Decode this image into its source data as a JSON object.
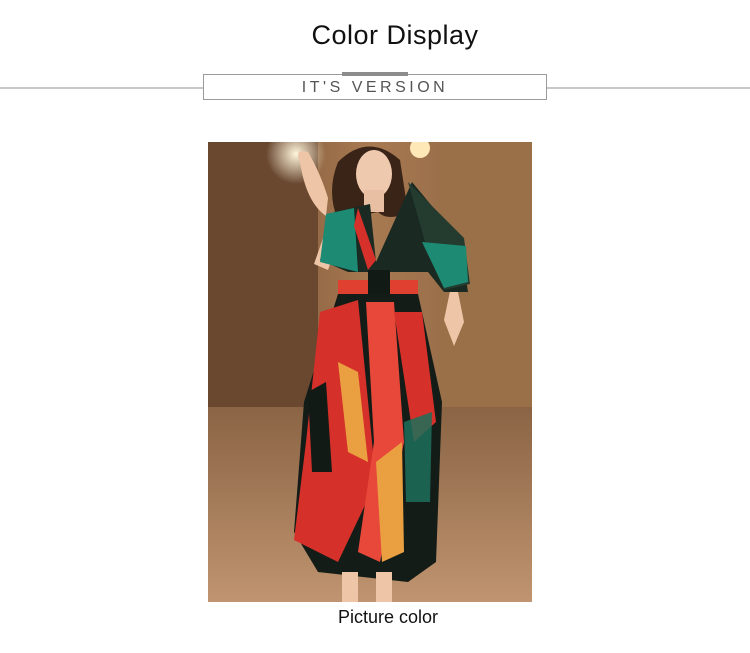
{
  "header": {
    "title": "Color Display",
    "subtitle": "IT'S VERSION"
  },
  "product_image": {
    "caption": "Picture color"
  },
  "colors": {
    "rule": "#c8c8c8",
    "box_border": "#9a9a9a",
    "accent_bar": "#8c8c8c"
  }
}
